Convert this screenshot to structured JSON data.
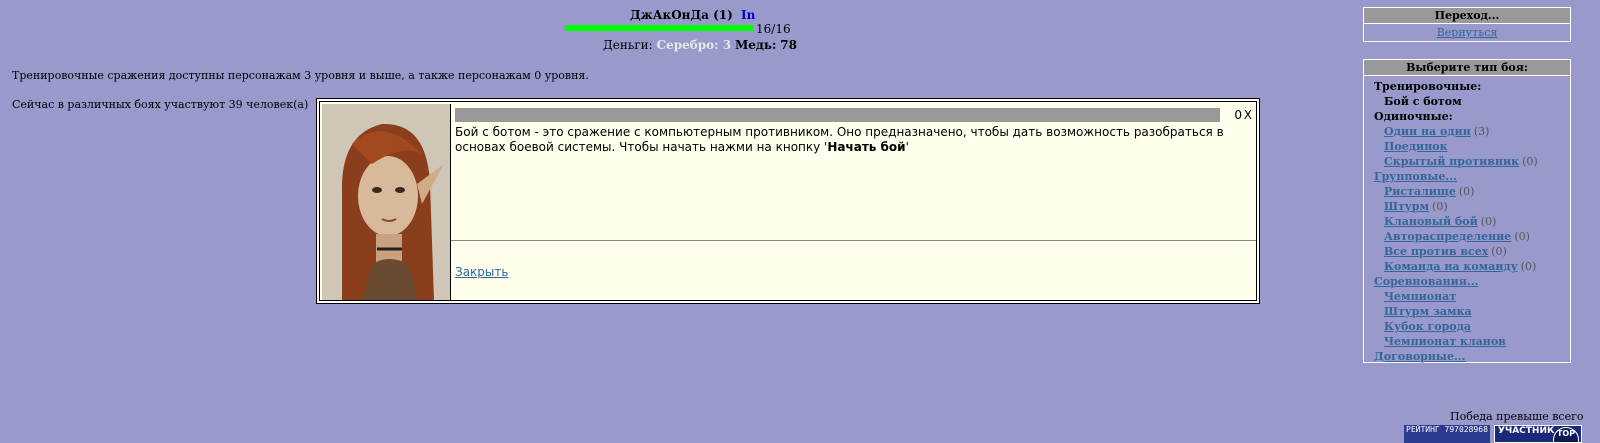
{
  "character": {
    "name": "ДжАкОнДа",
    "level": "(1)",
    "status": "In",
    "hp_text": "16/16",
    "hp_fraction": 1.0,
    "hp_color": "#00ff00"
  },
  "money": {
    "label": "Деньги:",
    "silver": "Серебро: 3",
    "copper_label": "Медь:",
    "copper_value": "78"
  },
  "info_text": "Тренировочные сражения доступны персонажам 3 уровня и выше, а также персонажам 0 уровня.",
  "participants_text": "Сейчас в различных боях участвуют 39 человек(а)",
  "dialog": {
    "counter": "0",
    "close_x": "X",
    "description_prefix": "Бой с ботом - это сражение с компьютерным противником. Оно предназначено, чтобы дать возможность разобраться в основах боевой системы. Чтобы начать нажми на кнопку '",
    "description_bold": "Начать бой",
    "description_suffix": "'",
    "close_link": "Закрыть"
  },
  "nav_panel": {
    "title": "Переход...",
    "back": "Вернуться"
  },
  "type_panel": {
    "title": "Выберите тип боя:",
    "items": [
      {
        "label": "Тренировочные:",
        "kind": "header"
      },
      {
        "label": "Бой с ботом",
        "kind": "plain-sub"
      },
      {
        "label": "Одиночные:",
        "kind": "header"
      },
      {
        "label": "Один на один",
        "count": "(3)",
        "kind": "link-sub"
      },
      {
        "label": "Поединок",
        "count": "",
        "kind": "link-sub"
      },
      {
        "label": "Скрытый противник",
        "count": "(0)",
        "kind": "link-sub"
      },
      {
        "label": "Групповые...",
        "kind": "link-header"
      },
      {
        "label": "Ристалище",
        "count": "(0)",
        "kind": "link-sub"
      },
      {
        "label": "Штурм",
        "count": "(0)",
        "kind": "link-sub"
      },
      {
        "label": "Клановый бой",
        "count": "(0)",
        "kind": "link-sub"
      },
      {
        "label": "Автораспределение",
        "count": "(0)",
        "kind": "link-sub"
      },
      {
        "label": "Все против всех",
        "count": "(0)",
        "kind": "link-sub"
      },
      {
        "label": "Команда на команду",
        "count": "(0)",
        "kind": "link-sub"
      },
      {
        "label": "Соревнования...",
        "kind": "link-header"
      },
      {
        "label": "Чемпионат",
        "count": "",
        "kind": "link-sub"
      },
      {
        "label": "Штурм замка",
        "count": "",
        "kind": "link-sub"
      },
      {
        "label": "Кубок города",
        "count": "",
        "kind": "link-sub"
      },
      {
        "label": "Чемпионат кланов",
        "count": "",
        "kind": "link-sub"
      },
      {
        "label": "Договорные...",
        "kind": "link-header"
      }
    ]
  },
  "footer": {
    "victory_text": "Победа превыше всего",
    "rating_badge": "РЕЙТИНГ 797028968",
    "member_badge": "УЧАСТНИК",
    "top_badge": "TOP"
  }
}
